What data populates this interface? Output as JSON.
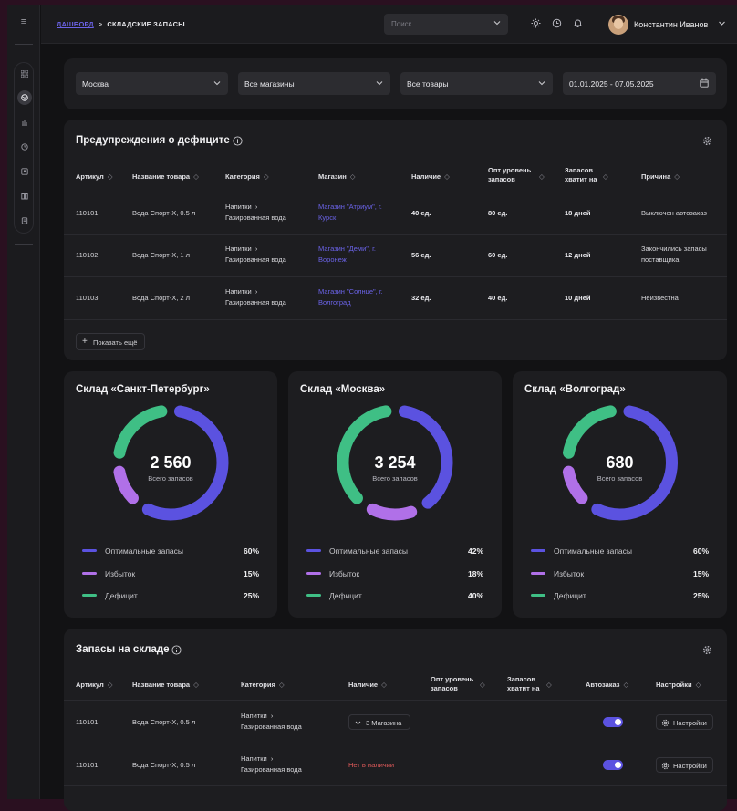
{
  "breadcrumb": {
    "root": "ДАШБОРД",
    "separator": ">",
    "current": "СКЛАДСКИЕ ЗАПАСЫ"
  },
  "search": {
    "placeholder": "Поиск"
  },
  "user": {
    "name": "Константин Иванов"
  },
  "filters": {
    "city": "Москва",
    "stores": "Все магазины",
    "products": "Все товары",
    "date_range": "01.01.2025 - 07.05.2025"
  },
  "deficit": {
    "title": "Предупреждения о дефиците",
    "columns": [
      "Артикул",
      "Название товара",
      "Категория",
      "Магазин",
      "Наличие",
      "Опт уровень запасов",
      "Запасов хватит на",
      "Причина"
    ],
    "rows": [
      {
        "sku": "110101",
        "name": "Вода Спорт-Х, 0.5 л",
        "cat1": "Напитки",
        "cat2": "Газированная вода",
        "store": "Магазин \"Атриум\", г. Курск",
        "stock": "40 ед.",
        "opt": "80 ед.",
        "days": "18 дней",
        "reason": "Выключен автозаказ"
      },
      {
        "sku": "110102",
        "name": "Вода Спорт-Х, 1 л",
        "cat1": "Напитки",
        "cat2": "Газированная вода",
        "store": "Магазин \"Деми\", г. Воронеж",
        "stock": "56 ед.",
        "opt": "60 ед.",
        "days": "12 дней",
        "reason": "Закончились запасы поставщика"
      },
      {
        "sku": "110103",
        "name": "Вода Спорт-Х, 2 л",
        "cat1": "Напитки",
        "cat2": "Газированная вода",
        "store": "Магазин \"Солнце\", г. Волгоград",
        "stock": "32 ед.",
        "opt": "40 ед.",
        "days": "10 дней",
        "reason": "Неизвестна"
      }
    ],
    "show_more": "Показать ещё"
  },
  "warehouses": [
    {
      "title": "Склад «Санкт-Петербург»",
      "total": "2 560",
      "total_label": "Всего запасов",
      "legend": [
        {
          "label": "Оптимальные запасы",
          "value": "60%",
          "pct": 60,
          "color": "#5b52e0"
        },
        {
          "label": "Избыток",
          "value": "15%",
          "pct": 15,
          "color": "#b070e8"
        },
        {
          "label": "Дефицит",
          "value": "25%",
          "pct": 25,
          "color": "#3fbf85"
        }
      ]
    },
    {
      "title": "Склад «Москва»",
      "total": "3 254",
      "total_label": "Всего запасов",
      "legend": [
        {
          "label": "Оптимальные запасы",
          "value": "42%",
          "pct": 42,
          "color": "#5b52e0"
        },
        {
          "label": "Избыток",
          "value": "18%",
          "pct": 18,
          "color": "#b070e8"
        },
        {
          "label": "Дефицит",
          "value": "40%",
          "pct": 40,
          "color": "#3fbf85"
        }
      ]
    },
    {
      "title": "Склад «Волгоград»",
      "total": "680",
      "total_label": "Всего запасов",
      "legend": [
        {
          "label": "Оптимальные запасы",
          "value": "60%",
          "pct": 60,
          "color": "#5b52e0"
        },
        {
          "label": "Избыток",
          "value": "15%",
          "pct": 15,
          "color": "#b070e8"
        },
        {
          "label": "Дефицит",
          "value": "25%",
          "pct": 25,
          "color": "#3fbf85"
        }
      ]
    }
  ],
  "stock": {
    "title": "Запасы на складе",
    "columns": [
      "Артикул",
      "Название товара",
      "Категория",
      "Наличие",
      "Опт уровень запасов",
      "Запасов хватит на",
      "Автозаказ",
      "Настройки"
    ],
    "rows": [
      {
        "sku": "110101",
        "name": "Вода Спорт-Х, 0.5 л",
        "cat1": "Напитки",
        "cat2": "Газированная вода",
        "availability": "3 Магазина",
        "autoorder": true,
        "settings": "Настройки"
      },
      {
        "sku": "110101",
        "name": "Вода Спорт-Х, 0.5 л",
        "cat1": "Напитки",
        "cat2": "Газированная вода",
        "availability": "Нет в наличии",
        "autoorder": true,
        "settings": "Настройки"
      }
    ]
  },
  "colors": {
    "accent": "#5b52e0",
    "excess": "#b070e8",
    "deficit": "#3fbf85",
    "out_of_stock": "#e05a5a"
  }
}
